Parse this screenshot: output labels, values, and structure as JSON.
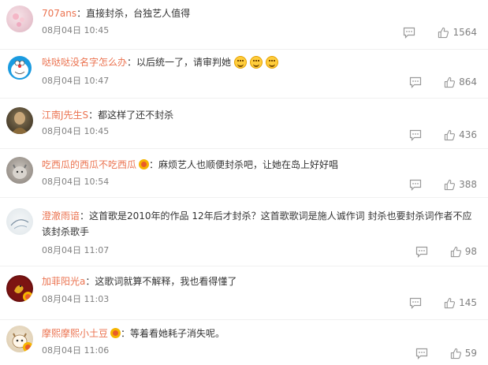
{
  "comments": [
    {
      "username": "707ans",
      "avatar": "pink-flower-avatar",
      "text": "：直接封杀，台独艺人值得",
      "emoji_count": 0,
      "vip": false,
      "time": "08月04日 10:45",
      "likes": "1564"
    },
    {
      "username": "哒哒哒没名字怎么办",
      "avatar": "doraemon-avatar",
      "text": "：以后统一了，请审判她",
      "emoji_count": 3,
      "vip": false,
      "time": "08月04日 10:47",
      "likes": "864"
    },
    {
      "username": "江南J先生S",
      "avatar": "monk-avatar",
      "text": "：都这样了还不封杀",
      "emoji_count": 0,
      "vip": false,
      "time": "08月04日 10:45",
      "likes": "436"
    },
    {
      "username": "吃西瓜的西瓜不吃西瓜",
      "avatar": "cat-avatar",
      "text": "：麻烦艺人也顺便封杀吧，让她在岛上好好唱",
      "emoji_count": 0,
      "vip": true,
      "time": "08月04日 10:54",
      "likes": "388"
    },
    {
      "username": "澄澈雨谙",
      "avatar": "bird-sketch-avatar",
      "text": "：这首歌是2010年的作品 12年后才封杀？这首歌歌词是施人诚作词 封杀也要封杀词作者不应该封杀歌手",
      "emoji_count": 0,
      "vip": false,
      "time": "08月04日 11:07",
      "likes": "98"
    },
    {
      "username": "加菲阳光a",
      "avatar": "dragon-avatar",
      "text": "：这歌词就算不解释，我也看得懂了",
      "emoji_count": 0,
      "vip": false,
      "time": "08月04日 11:03",
      "likes": "145"
    },
    {
      "username": "摩熙摩熙小土豆",
      "avatar": "cartoon-cat-avatar",
      "text": "：等着看她耗子消失呢。",
      "emoji_count": 0,
      "vip": true,
      "time": "08月04日 11:06",
      "likes": "59"
    }
  ],
  "colors": {
    "username": "#eb7350",
    "meta": "#808080",
    "text": "#333333"
  }
}
